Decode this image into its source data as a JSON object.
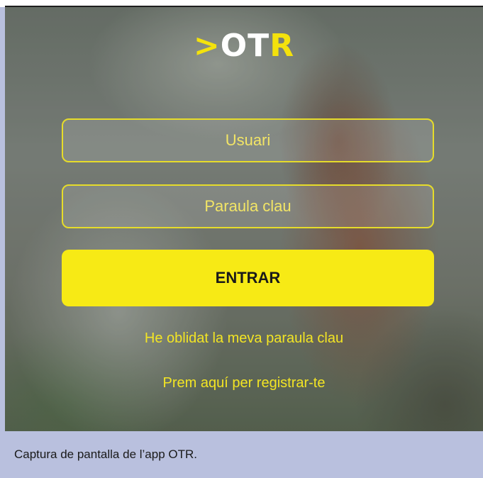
{
  "app": {
    "logo_prefix": ">",
    "logo_white": "OT",
    "logo_accent": "R"
  },
  "login": {
    "username_placeholder": "Usuari",
    "password_placeholder": "Paraula clau",
    "submit_label": "ENTRAR",
    "forgot_password_label": "He oblidat la meva paraula clau",
    "register_label": "Prem aquí per registrar-te"
  },
  "caption": {
    "text": "Captura de pantalla de l’app OTR."
  },
  "colors": {
    "accent": "#f7ea15",
    "caption_background": "#b9c0de"
  }
}
